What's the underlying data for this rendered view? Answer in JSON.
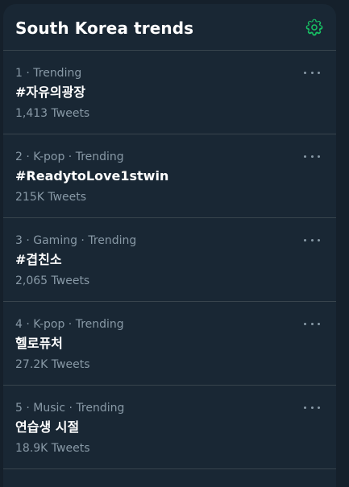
{
  "header": {
    "title": "South Korea trends",
    "settings_icon": "gear-icon",
    "accent_color": "#17bf63"
  },
  "trends": [
    {
      "meta": "1 · Trending",
      "name": "#자유의광장",
      "count": "1,413 Tweets"
    },
    {
      "meta": "2 · K-pop · Trending",
      "name": "#ReadytoLove1stwin",
      "count": "215K Tweets"
    },
    {
      "meta": "3 · Gaming · Trending",
      "name": "#겹친소",
      "count": "2,065 Tweets"
    },
    {
      "meta": "4 · K-pop · Trending",
      "name": "헬로퓨처",
      "count": "27.2K Tweets"
    },
    {
      "meta": "5 · Music · Trending",
      "name": "연습생 시절",
      "count": "18.9K Tweets"
    }
  ],
  "more_icon": "more-horizontal-icon"
}
